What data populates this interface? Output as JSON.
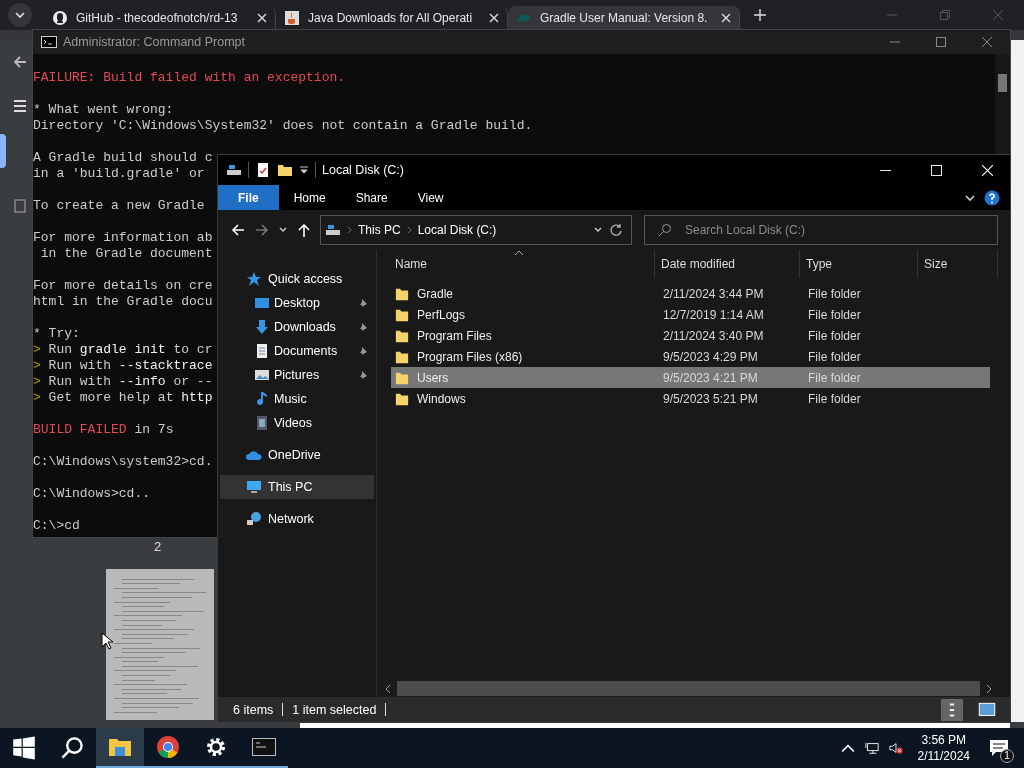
{
  "browser": {
    "tabs": [
      {
        "title": "GitHub - thecodeofnotch/rd-13",
        "kind": "github",
        "selected": false
      },
      {
        "title": "Java Downloads for All Operati",
        "kind": "java",
        "selected": false
      },
      {
        "title": "Gradle User Manual: Version 8.",
        "kind": "gradle",
        "selected": true
      }
    ],
    "page_number": "2"
  },
  "cmd": {
    "title": "Administrator: Command Prompt",
    "paragraphs": [
      [
        {
          "segments": [
            {
              "text": "FAILURE: Build failed with an exception.",
              "kind": "error"
            }
          ]
        }
      ],
      [
        {
          "segments": [
            {
              "text": "* What went wrong:",
              "kind": "plain"
            }
          ]
        },
        {
          "segments": [
            {
              "text": "Directory 'C:\\Windows\\System32' does not contain a Gradle build.",
              "kind": "plain"
            }
          ]
        }
      ],
      [
        {
          "segments": [
            {
              "text": "A Gradle build should c",
              "kind": "plain"
            }
          ]
        },
        {
          "segments": [
            {
              "text": "in a 'build.gradle' or",
              "kind": "plain"
            }
          ]
        }
      ],
      [
        {
          "segments": [
            {
              "text": "To create a new Gradle",
              "kind": "plain"
            }
          ]
        }
      ],
      [
        {
          "segments": [
            {
              "text": "For more information ab",
              "kind": "plain"
            }
          ]
        },
        {
          "segments": [
            {
              "text": " in the Gradle document",
              "kind": "plain"
            }
          ]
        }
      ],
      [
        {
          "segments": [
            {
              "text": "For more details on cre",
              "kind": "plain"
            }
          ]
        },
        {
          "segments": [
            {
              "text": "html in the Gradle docu",
              "kind": "plain"
            }
          ]
        }
      ],
      [
        {
          "segments": [
            {
              "text": "* Try:",
              "kind": "plain"
            }
          ]
        },
        {
          "segments": [
            {
              "text": ">",
              "kind": "accent"
            },
            {
              "text": " Run ",
              "kind": "plain"
            },
            {
              "text": "gradle init",
              "kind": "bright"
            },
            {
              "text": " to cr",
              "kind": "plain"
            }
          ]
        },
        {
          "segments": [
            {
              "text": ">",
              "kind": "accent"
            },
            {
              "text": " Run with ",
              "kind": "plain"
            },
            {
              "text": "--stacktrace",
              "kind": "bright"
            }
          ]
        },
        {
          "segments": [
            {
              "text": ">",
              "kind": "accent"
            },
            {
              "text": " Run with ",
              "kind": "plain"
            },
            {
              "text": "--info",
              "kind": "bright"
            },
            {
              "text": " or --",
              "kind": "plain"
            }
          ]
        },
        {
          "segments": [
            {
              "text": ">",
              "kind": "accent"
            },
            {
              "text": " Get more help at ",
              "kind": "plain"
            },
            {
              "text": "http",
              "kind": "bright"
            }
          ]
        }
      ],
      [
        {
          "segments": [
            {
              "text": "BUILD FAILED",
              "kind": "error"
            },
            {
              "text": " in 7s",
              "kind": "plain"
            }
          ]
        }
      ],
      [
        {
          "segments": [
            {
              "text": "C:\\Windows\\system32>cd.",
              "kind": "plain"
            }
          ]
        }
      ],
      [
        {
          "segments": [
            {
              "text": "C:\\Windows>cd..",
              "kind": "plain"
            }
          ]
        }
      ],
      [
        {
          "segments": [
            {
              "text": "C:\\>cd",
              "kind": "plain"
            }
          ]
        }
      ]
    ]
  },
  "explorer": {
    "title": "Local Disk (C:)",
    "ribbon_tabs": [
      {
        "label": "File",
        "selected": true
      },
      {
        "label": "Home",
        "selected": false
      },
      {
        "label": "Share",
        "selected": false
      },
      {
        "label": "View",
        "selected": false
      }
    ],
    "breadcrumb": [
      "This PC",
      "Local Disk (C:)"
    ],
    "search": {
      "placeholder": "Search Local Disk (C:)"
    },
    "nav": [
      {
        "label": "Quick access",
        "kind": "star",
        "selected": false,
        "children": [
          {
            "label": "Desktop",
            "kind": "desktop",
            "selected": false,
            "pinned": true
          },
          {
            "label": "Downloads",
            "kind": "download",
            "selected": false,
            "pinned": true
          },
          {
            "label": "Documents",
            "kind": "document",
            "selected": false,
            "pinned": true
          },
          {
            "label": "Pictures",
            "kind": "picture",
            "selected": false,
            "pinned": true
          },
          {
            "label": "Music",
            "kind": "music",
            "selected": false,
            "pinned": false
          },
          {
            "label": "Videos",
            "kind": "video",
            "selected": false,
            "pinned": false
          }
        ]
      },
      {
        "label": "OneDrive",
        "kind": "cloud",
        "selected": false
      },
      {
        "label": "This PC",
        "kind": "computer",
        "selected": true
      },
      {
        "label": "Network",
        "kind": "network",
        "selected": false
      }
    ],
    "columns": [
      "Name",
      "Date modified",
      "Type",
      "Size"
    ],
    "rows": [
      {
        "name": "Gradle",
        "date": "2/11/2024 3:44 PM",
        "type": "File folder",
        "selected": false
      },
      {
        "name": "PerfLogs",
        "date": "12/7/2019 1:14 AM",
        "type": "File folder",
        "selected": false
      },
      {
        "name": "Program Files",
        "date": "2/11/2024 3:40 PM",
        "type": "File folder",
        "selected": false
      },
      {
        "name": "Program Files (x86)",
        "date": "9/5/2023 4:29 PM",
        "type": "File folder",
        "selected": false
      },
      {
        "name": "Users",
        "date": "9/5/2023 4:21 PM",
        "type": "File folder",
        "selected": true
      },
      {
        "name": "Windows",
        "date": "9/5/2023 5:21 PM",
        "type": "File folder",
        "selected": false
      }
    ],
    "status": {
      "count": "6 items",
      "selection": "1 item selected"
    }
  },
  "taskbar": {
    "apps": [
      {
        "kind": "explorer",
        "active": true
      },
      {
        "kind": "chrome",
        "active": false
      },
      {
        "kind": "settings",
        "active": false
      },
      {
        "kind": "terminal",
        "active": false
      }
    ],
    "time": "3:56 PM",
    "date": "2/11/2024",
    "notifications": "1"
  }
}
